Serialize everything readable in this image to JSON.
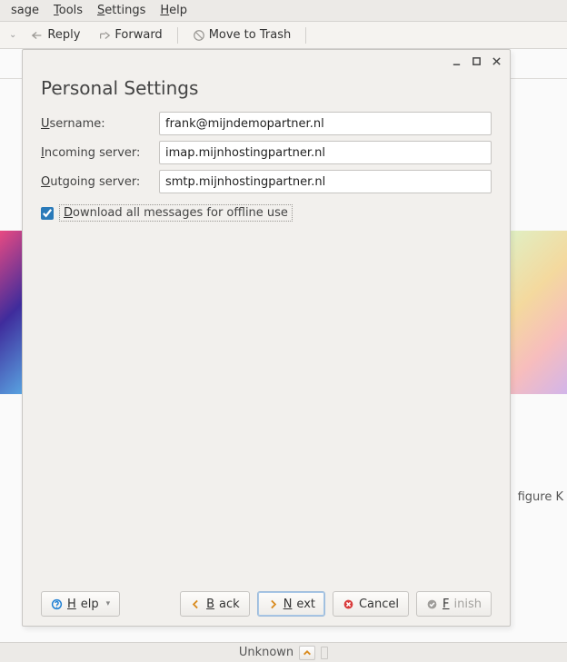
{
  "menubar": {
    "items": [
      {
        "label": "sage",
        "accel": ""
      },
      {
        "label": "Tools",
        "accel": "T"
      },
      {
        "label": "Settings",
        "accel": "S"
      },
      {
        "label": "Help",
        "accel": "H"
      }
    ]
  },
  "toolbar": {
    "reply": "Reply",
    "forward": "Forward",
    "trash": "Move to Trash"
  },
  "dialog": {
    "title": "Personal Settings",
    "labels": {
      "username": "Username:",
      "incoming": "Incoming server:",
      "outgoing": "Outgoing server:"
    },
    "values": {
      "username": "frank@mijndemopartner.nl",
      "incoming": "imap.mijnhostingpartner.nl",
      "outgoing": "smtp.mijnhostingpartner.nl"
    },
    "checkbox": {
      "checked": true,
      "label": "Download all messages for offline use"
    },
    "buttons": {
      "help": "Help",
      "back": "Back",
      "next": "Next",
      "cancel": "Cancel",
      "finish": "Finish"
    }
  },
  "background": {
    "side_text": "figure K"
  },
  "statusbar": {
    "text": "Unknown"
  }
}
